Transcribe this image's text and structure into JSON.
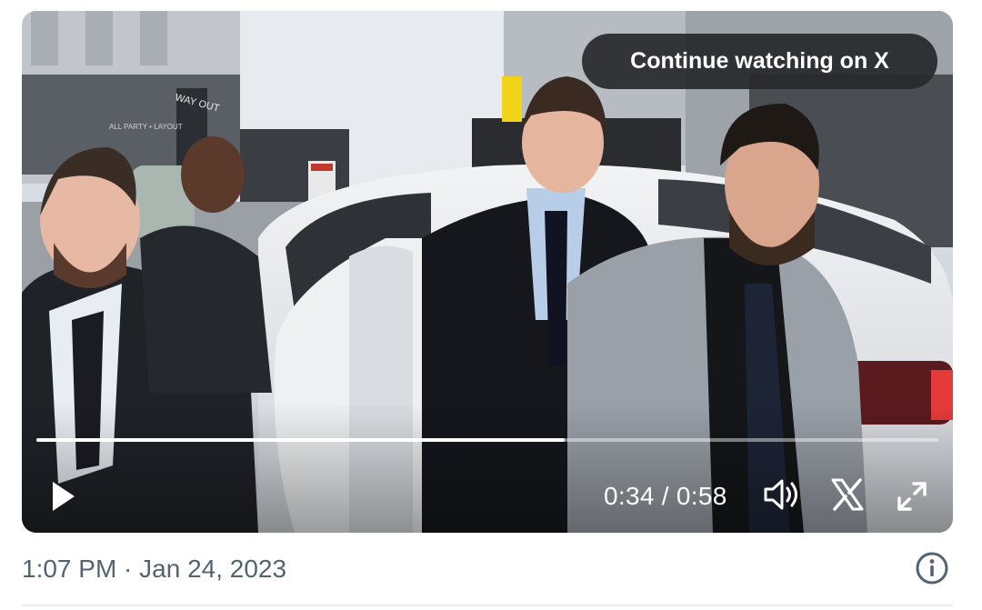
{
  "video": {
    "continue_label": "Continue watching on X",
    "time_display": "0:34 / 0:58",
    "progress": 0.586,
    "scene_signs": {
      "way_out": "WAY OUT",
      "garage_wall": "ALL PARTY • LAYOUT"
    },
    "controls": {
      "play": "play-icon",
      "volume": "volume-icon",
      "brand": "x-logo-icon",
      "fullscreen": "fullscreen-icon"
    }
  },
  "tweet": {
    "timestamp": "1:07 PM · Jan 24, 2023",
    "info_icon": "info-icon"
  },
  "colors": {
    "pill_bg": "#26282b",
    "meta_text": "#536471",
    "divider": "#e6ecf0"
  }
}
